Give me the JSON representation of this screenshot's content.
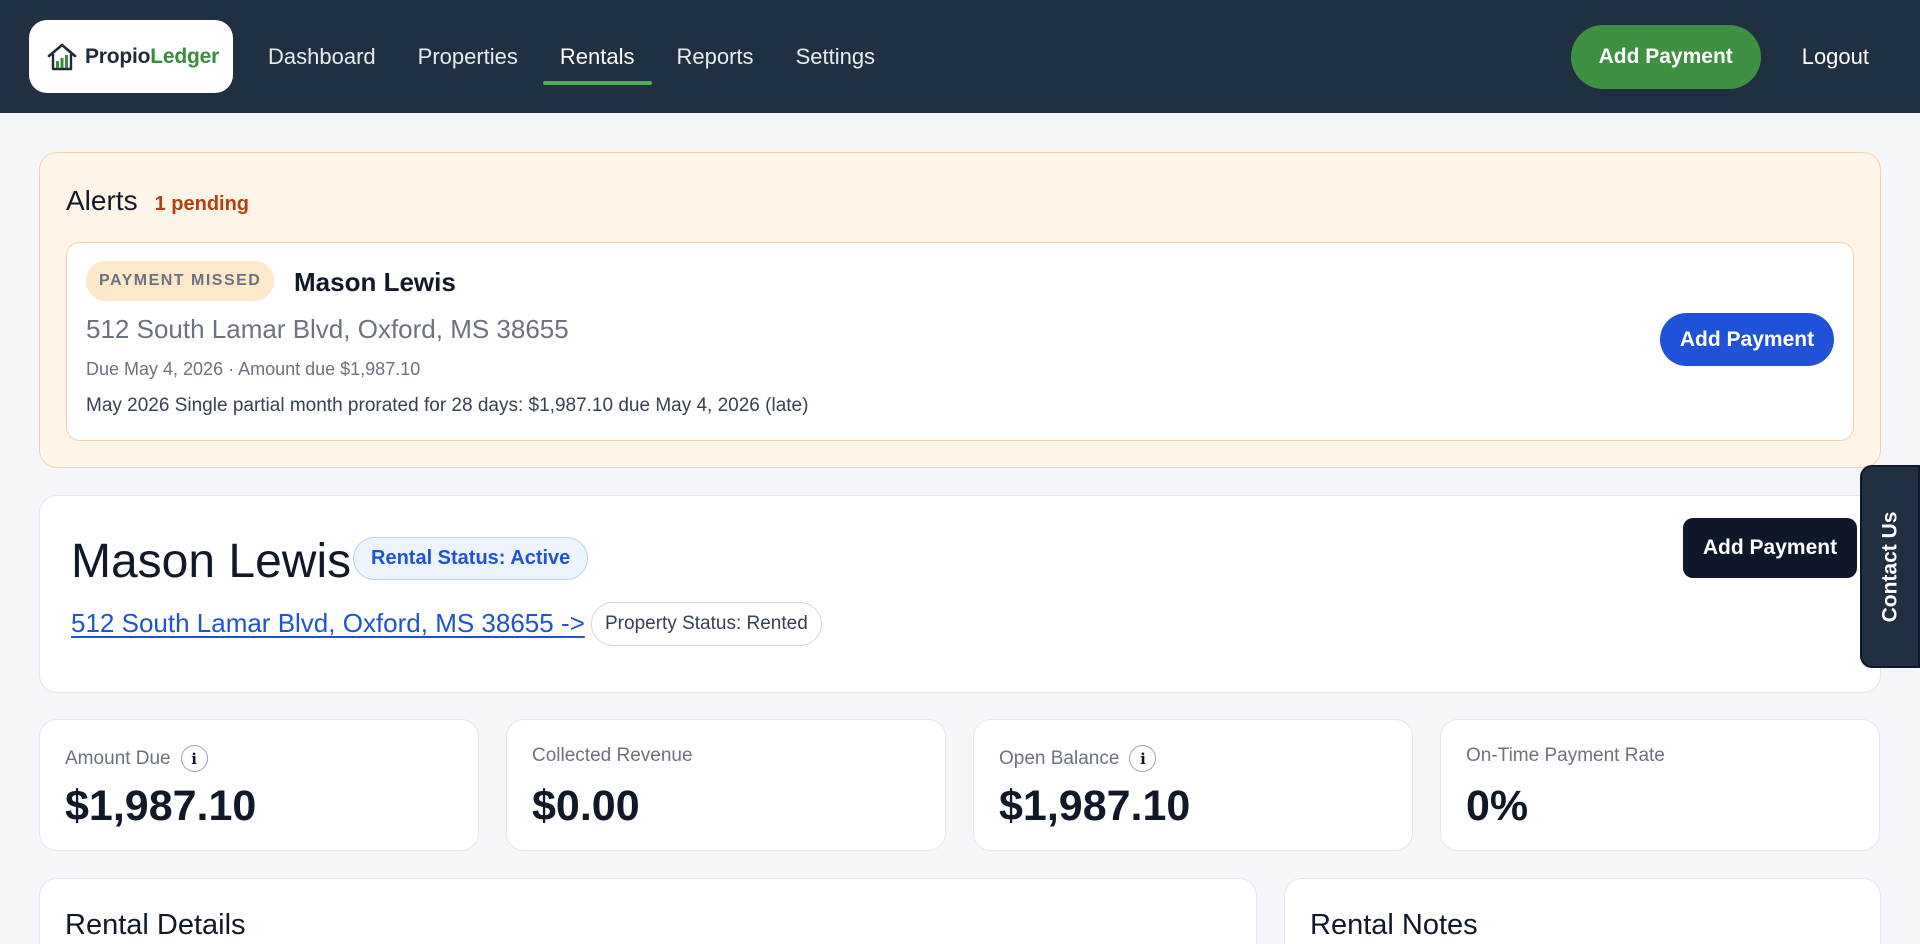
{
  "app": {
    "logo_part1": "Propio",
    "logo_part2": "Ledger"
  },
  "nav": {
    "links": [
      {
        "label": "Dashboard"
      },
      {
        "label": "Properties"
      },
      {
        "label": "Rentals",
        "active": true
      },
      {
        "label": "Reports"
      },
      {
        "label": "Settings"
      }
    ],
    "add_payment_label": "Add Payment",
    "logout_label": "Logout"
  },
  "alerts": {
    "title": "Alerts",
    "count_label": "1 pending",
    "items": [
      {
        "badge": "PAYMENT MISSED",
        "name": "Mason Lewis",
        "address": "512 South Lamar Blvd, Oxford, MS 38655",
        "due_line": "Due May 4, 2026 · Amount due $1,987.10",
        "note": "May 2026 Single partial month prorated for 28 days: $1,987.10 due May 4, 2026 (late)",
        "action_label": "Add Payment"
      }
    ]
  },
  "tenant": {
    "name": "Mason Lewis",
    "rental_status": "Rental Status: Active",
    "property_link": "512 South Lamar Blvd, Oxford, MS 38655 ->",
    "property_status": "Property Status: Rented",
    "add_payment_label": "Add Payment"
  },
  "contact": {
    "label": "Contact Us"
  },
  "stats": [
    {
      "label": "Amount Due",
      "value": "$1,987.10",
      "info": true
    },
    {
      "label": "Collected Revenue",
      "value": "$0.00",
      "info": false
    },
    {
      "label": "Open Balance",
      "value": "$1,987.10",
      "info": true
    },
    {
      "label": "On-Time Payment Rate",
      "value": "0%",
      "info": false
    }
  ],
  "sections": {
    "details_title": "Rental Details",
    "notes_title": "Rental Notes"
  },
  "colors": {
    "nav_bg": "#203042",
    "accent_green": "#3f9142",
    "accent_blue": "#1f52d6",
    "alert_bg": "#fff4e8"
  }
}
